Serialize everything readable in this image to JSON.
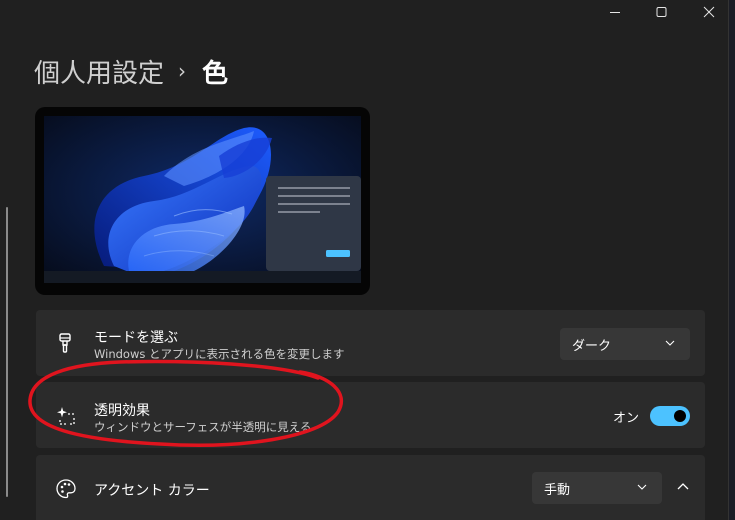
{
  "window": {
    "minimize_icon": "minimize-icon",
    "maximize_icon": "maximize-icon",
    "close_icon": "close-icon"
  },
  "breadcrumb": {
    "parent": "個人用設定",
    "separator": "›",
    "current": "色"
  },
  "settings": {
    "mode": {
      "icon": "paintbrush-icon",
      "title": "モードを選ぶ",
      "description": "Windows とアプリに表示される色を変更します",
      "selected": "ダーク"
    },
    "transparency": {
      "icon": "sparkle-icon",
      "title": "透明効果",
      "description": "ウィンドウとサーフェスが半透明に見える",
      "state_label": "オン",
      "enabled": true
    },
    "accent": {
      "icon": "palette-icon",
      "title": "アクセント カラー",
      "selected": "手動",
      "expanded": true
    }
  },
  "colors": {
    "accent": "#4cc2ff",
    "card_background": "#2b2b2b",
    "window_background": "#202020",
    "annotation": "#e0141e"
  }
}
